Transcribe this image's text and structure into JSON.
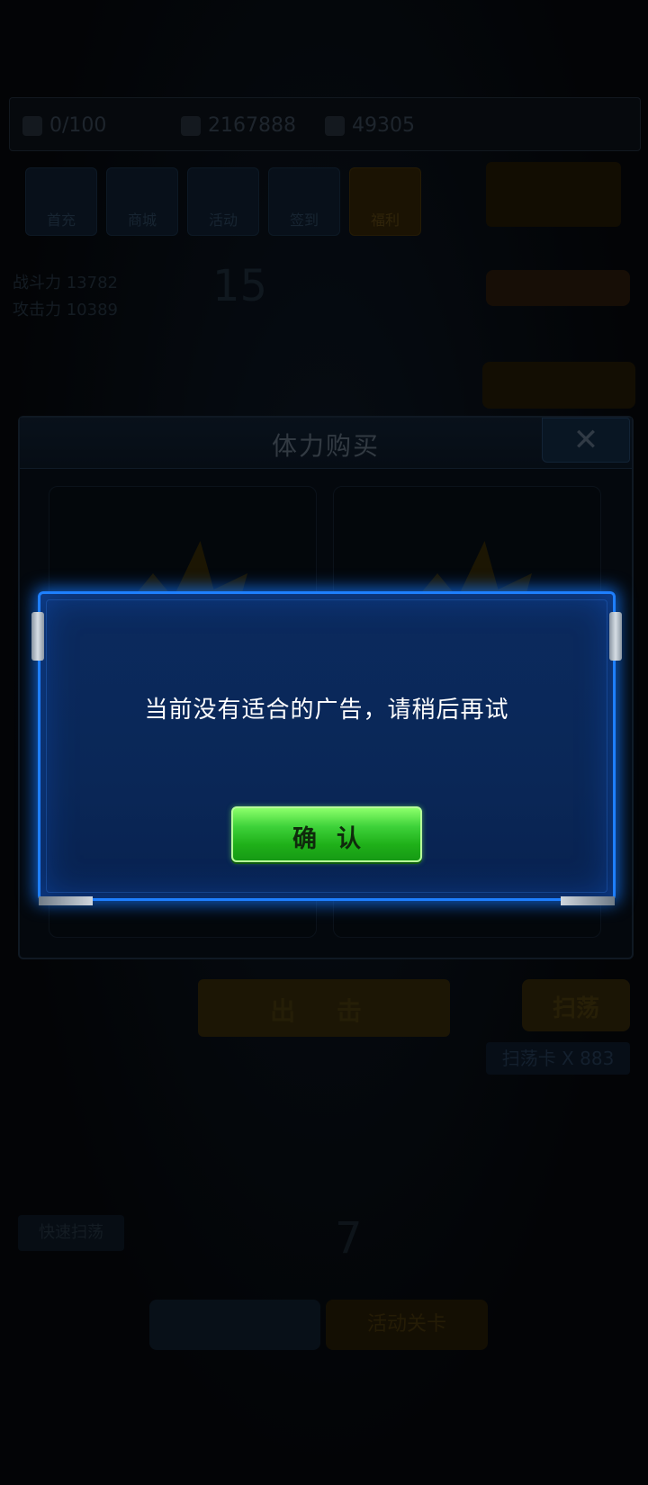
{
  "background": {
    "resources": [
      "0/100",
      "2167888",
      "49305"
    ],
    "tiles": [
      "首充",
      "商城",
      "活动",
      "签到",
      "福利"
    ],
    "left_stats": [
      "战斗力 13782",
      "攻击力 10389"
    ],
    "stage_level": "15",
    "stage_level_2": "7",
    "panel_title": "体力购买",
    "close_label": "✕",
    "attack_button": "出 击",
    "sweep_button": "扫荡",
    "sweep_count": "扫荡卡 X 883",
    "quick_sweep": "快速扫荡",
    "event_label": "活动关卡"
  },
  "dialog": {
    "message": "当前没有适合的广告，请稍后再试",
    "confirm_label": "确认"
  },
  "colors": {
    "dialog_border": "#1e7fff",
    "dialog_bg": "#0a2757",
    "confirm_green": "#3ed23a"
  }
}
